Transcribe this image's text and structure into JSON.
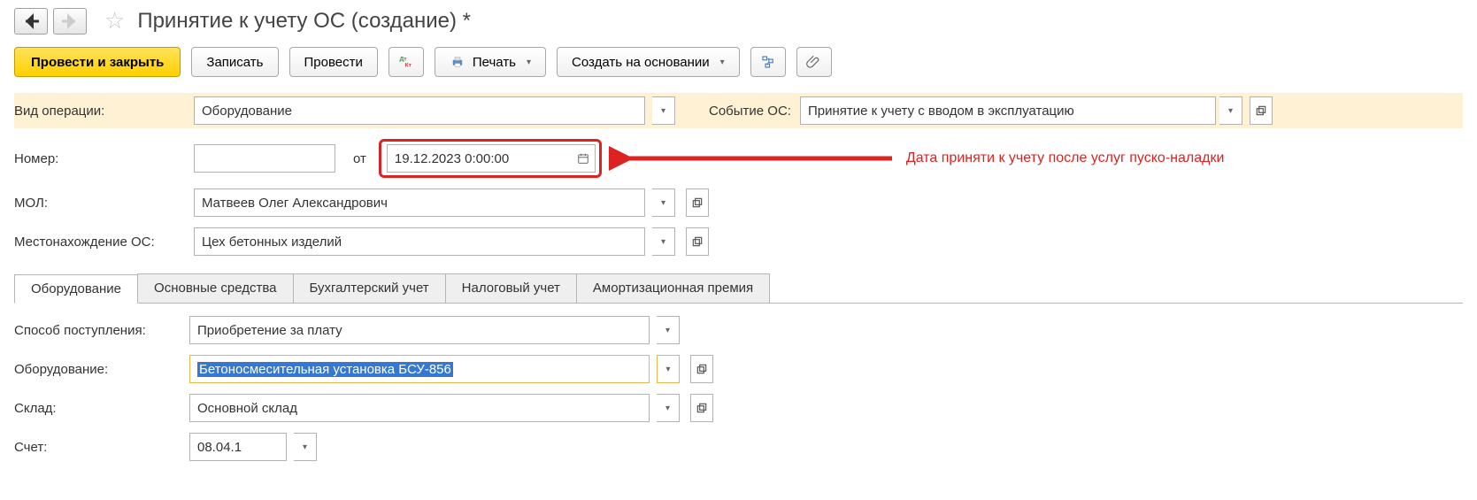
{
  "page_title": "Принятие к учету ОС (создание) *",
  "toolbar": {
    "post_and_close": "Провести и закрыть",
    "save": "Записать",
    "post": "Провести",
    "print": "Печать",
    "create_based_on": "Создать на основании"
  },
  "operation_type": {
    "label": "Вид операции:",
    "value": "Оборудование"
  },
  "event": {
    "label": "Событие ОС:",
    "value": "Принятие к учету с вводом в эксплуатацию"
  },
  "number": {
    "label": "Номер:",
    "from_label": "от",
    "date_value": "19.12.2023  0:00:00"
  },
  "annotation": "Дата приняти к учету  после услуг пуско-наладки",
  "mol": {
    "label": "МОЛ:",
    "value": "Матвеев Олег Александрович"
  },
  "location": {
    "label": "Местонахождение ОС:",
    "value": "Цех бетонных изделий"
  },
  "tabs": {
    "equipment": "Оборудование",
    "fixed_assets": "Основные средства",
    "accounting": "Бухгалтерский учет",
    "tax": "Налоговый учет",
    "bonus": "Амортизационная премия"
  },
  "tab_equipment": {
    "method_label": "Способ поступления:",
    "method_value": "Приобретение за плату",
    "equipment_label": "Оборудование:",
    "equipment_value": "Бетоносмесительная установка БСУ-856",
    "warehouse_label": "Склад:",
    "warehouse_value": "Основной склад",
    "account_label": "Счет:",
    "account_value": "08.04.1"
  }
}
